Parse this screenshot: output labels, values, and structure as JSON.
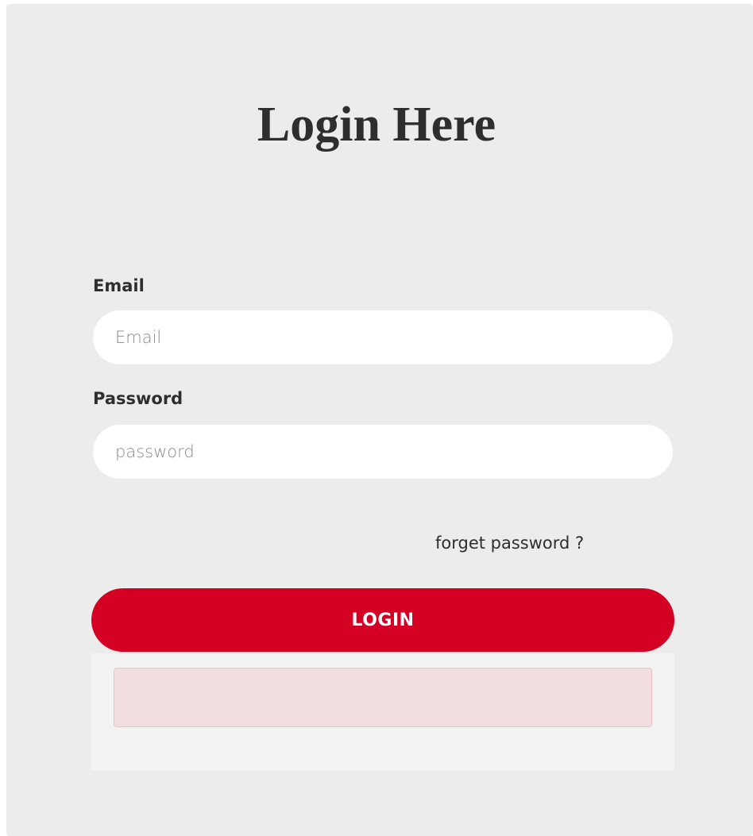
{
  "login_form": {
    "title": "Login Here",
    "email": {
      "label": "Email",
      "value": "",
      "placeholder": "Email"
    },
    "password": {
      "label": "Password",
      "value": "",
      "placeholder": "password"
    },
    "forgot_password_link": "forget password ?",
    "submit_label": "LOGIN",
    "error_message": ""
  },
  "colors": {
    "card_background": "#ececec",
    "accent": "#d30024",
    "error_background": "#f3dedf",
    "text": "#2e2e2e"
  }
}
